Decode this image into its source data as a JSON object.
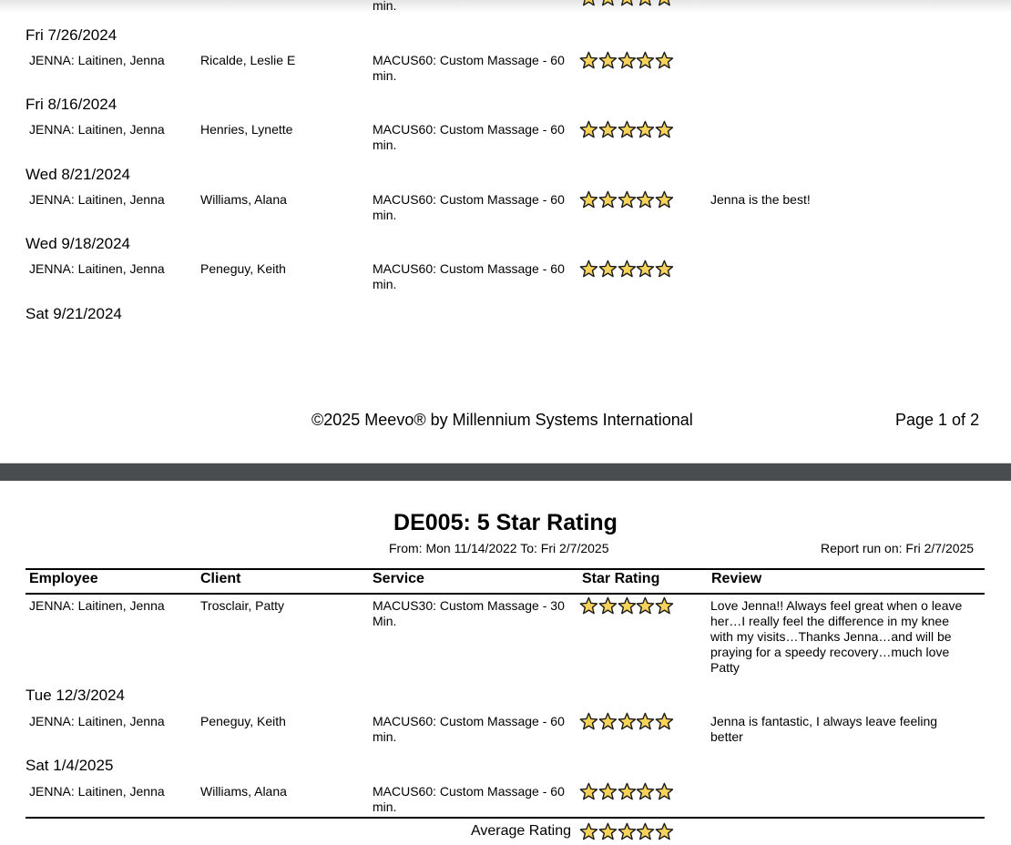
{
  "page1": {
    "top_fragment": "min.",
    "groups": [
      {
        "date": "Fri 7/26/2024",
        "employee": "JENNA: Laitinen, Jenna",
        "client": "Ricalde, Leslie E",
        "service_line1": "MACUS60: Custom Massage - 60",
        "service_line2": "min.",
        "review": ""
      },
      {
        "date": "Fri 8/16/2024",
        "employee": "JENNA: Laitinen, Jenna",
        "client": "Henries, Lynette",
        "service_line1": "MACUS60: Custom Massage - 60",
        "service_line2": "min.",
        "review": ""
      },
      {
        "date": "Wed 8/21/2024",
        "employee": "JENNA: Laitinen, Jenna",
        "client": "Williams, Alana",
        "service_line1": "MACUS60: Custom Massage - 60",
        "service_line2": "min.",
        "review": "Jenna is the best!"
      },
      {
        "date": "Wed 9/18/2024",
        "employee": "JENNA: Laitinen, Jenna",
        "client": "Peneguy, Keith",
        "service_line1": "MACUS60: Custom Massage - 60",
        "service_line2": "min.",
        "review": ""
      }
    ],
    "trailing_date": "Sat 9/21/2024",
    "footer_copyright": "©2025 Meevo® by Millennium Systems International",
    "footer_page": "Page 1 of 2"
  },
  "page2": {
    "title": "DE005: 5 Star Rating",
    "date_range": "From: Mon 11/14/2022 To: Fri 2/7/2025",
    "report_run": "Report run on: Fri 2/7/2025",
    "columns": {
      "employee": "Employee",
      "client": "Client",
      "service": "Service",
      "star_rating": "Star Rating",
      "review": "Review"
    },
    "first_row": {
      "employee": "JENNA: Laitinen, Jenna",
      "client": "Trosclair, Patty",
      "service_line1": "MACUS30: Custom Massage - 30",
      "service_line2": "Min.",
      "review_lines": [
        "Love Jenna!! Always feel great when o leave",
        "her…I really feel the difference in my knee",
        "with my visits…Thanks Jenna…and will be",
        "praying for a speedy recovery…much love",
        "Patty"
      ]
    },
    "groups": [
      {
        "date": "Tue 12/3/2024",
        "employee": "JENNA: Laitinen, Jenna",
        "client": "Peneguy, Keith",
        "service_line1": "MACUS60: Custom Massage - 60",
        "service_line2": "min.",
        "review_line1": "Jenna is fantastic, I always leave feeling",
        "review_line2": "better"
      },
      {
        "date": "Sat 1/4/2025",
        "employee": "JENNA: Laitinen, Jenna",
        "client": "Williams, Alana",
        "service_line1": "MACUS60: Custom Massage - 60",
        "service_line2": "min.",
        "review_line1": "",
        "review_line2": ""
      }
    ],
    "average_label": "Average Rating"
  },
  "rating": {
    "stars": 5,
    "max": 5
  },
  "colors": {
    "star_fill": "#f7d35a",
    "star_stroke": "#1a1a1a",
    "separator": "#4a4d50"
  }
}
